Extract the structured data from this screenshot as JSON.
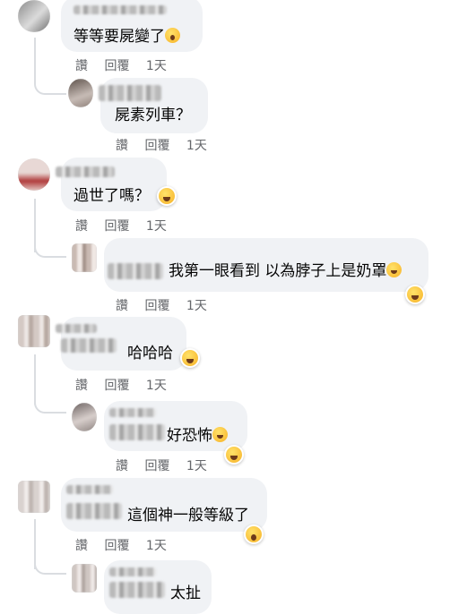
{
  "actions": {
    "like": "讚",
    "reply": "回覆",
    "time": "1天"
  },
  "comments": [
    {
      "text": "等等要屍變了"
    },
    {
      "text": "屍素列車？"
    },
    {
      "text": "過世了嗎？"
    },
    {
      "text": "我第一眼看到 以為脖子上是奶罩"
    },
    {
      "text": "哈哈哈"
    },
    {
      "text": "好恐怖"
    },
    {
      "text": "這個神一般等級了"
    },
    {
      "text": "太扯"
    }
  ],
  "icons": {
    "inline_scream": "face-screaming-in-fear",
    "inline_laugh": "rolling-on-floor-laughing",
    "reaction_laugh": "haha-reaction",
    "reaction_wow": "wow-reaction"
  }
}
